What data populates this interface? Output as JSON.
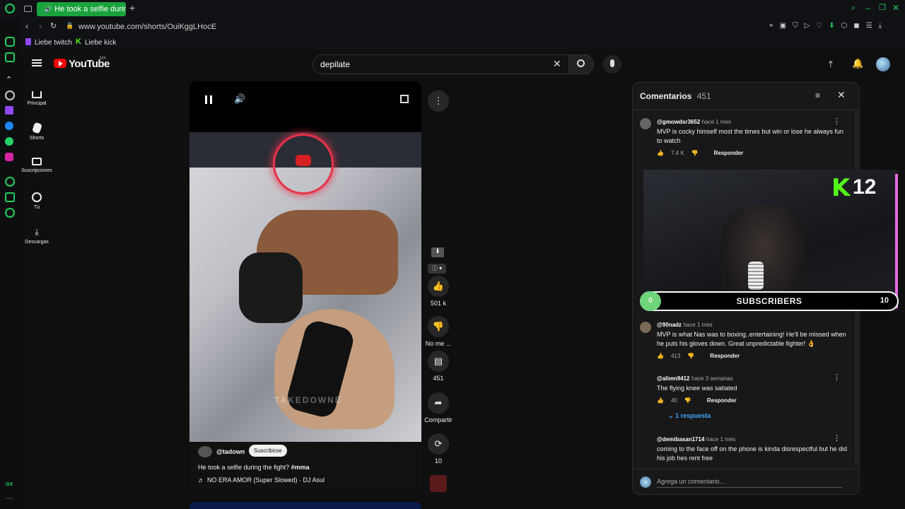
{
  "browser": {
    "tab_title": "He took a selfie during",
    "url": "www.youtube.com/shorts/OuiKggLHocE",
    "bookmarks": [
      "Liebe twitch",
      "Liebe kick"
    ]
  },
  "youtube": {
    "logo_text": "YouTube",
    "region": "MX",
    "search_value": "depilate",
    "nav": [
      {
        "label": "Principal",
        "icon": "home-icon"
      },
      {
        "label": "Shorts",
        "icon": "shorts-icon"
      },
      {
        "label": "Suscripciones",
        "icon": "subscriptions-icon"
      },
      {
        "label": "Tú",
        "icon": "you-icon"
      },
      {
        "label": "Descargas",
        "icon": "download-icon"
      }
    ]
  },
  "short": {
    "channel": "@tadown",
    "subscribe_label": "Suscribirse",
    "title": "He took a selfie during the fight?",
    "hashtag": "#mma",
    "music": "NO ERA AMOR (Super Slowed) · DJ Asul",
    "watermark": "TAKEDOWNE",
    "like_count": "501 k",
    "dislike_label": "No me ...",
    "comment_count": "451",
    "share_label": "Compartir",
    "remix_count": "10"
  },
  "comments_panel": {
    "title": "Comentarios",
    "count": "451",
    "input_placeholder": "Agrega un comentario...",
    "reply_label": "Responder",
    "items": [
      {
        "user": "@gmowdsr3652",
        "time": "hace 1 mes",
        "text": "MVP is cocky himself most the times but win or lose he always fun to watch",
        "likes": "7.4 K"
      },
      {
        "user": "@90nadz",
        "time": "hace 1 mes",
        "text": "MVP is what Nas was to boxing..entertaining! He'll be missed when he puts his gloves down. Great unpredictable fighter! 👌",
        "likes": "413"
      },
      {
        "user": "@alimn9412",
        "time": "hace 3 semanas",
        "text": "The flying knee was satiated",
        "likes": "40",
        "replies": "1 respuesta"
      },
      {
        "user": "@demibasan1714",
        "time": "hace 1 mes",
        "text": "coming to the face off on the phone is kinda disrespectful but he did his job hes rent free",
        "likes": ""
      }
    ]
  },
  "stream_overlay": {
    "kick_count": "12",
    "subscribers_label": "SUBSCRIBERS",
    "goal_current": "0",
    "goal_target": "10",
    "goal_progress": 0.05
  },
  "colors": {
    "accent": "#1aa33d",
    "kick_green": "#53fc18",
    "yt_red": "#ff0000"
  }
}
